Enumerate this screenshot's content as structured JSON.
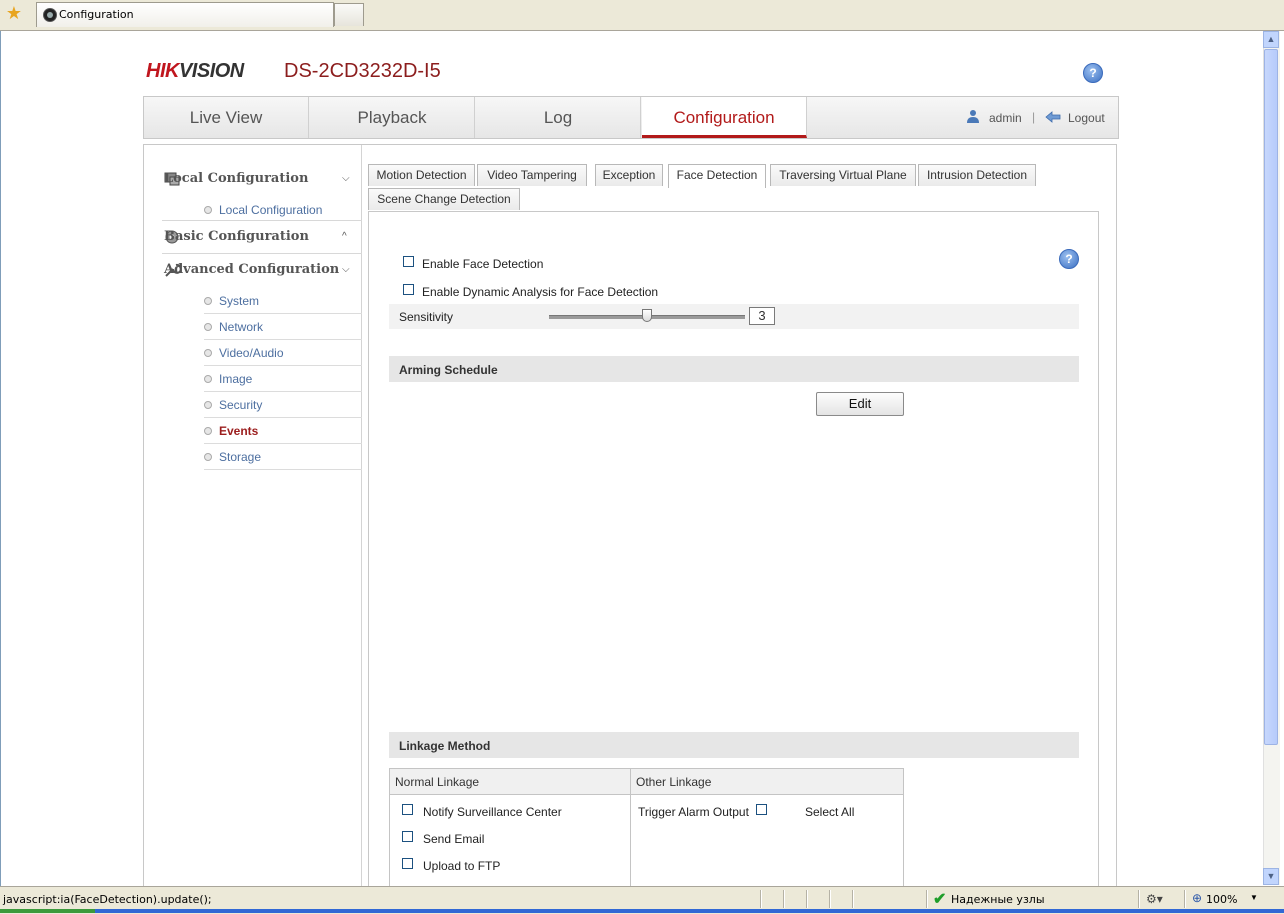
{
  "browser": {
    "tab_title": "Configuration",
    "status_text": "javascript:ia(FaceDetection).update();",
    "zone_text": "Надежные узлы",
    "zoom": "100%"
  },
  "header": {
    "logo_hik": "HIK",
    "logo_vision": "VISION",
    "model": "DS-2CD3232D-I5",
    "help": "?"
  },
  "nav": {
    "tabs": [
      "Live View",
      "Playback",
      "Log",
      "Configuration"
    ],
    "active": "Configuration",
    "user": "admin",
    "separator": "|",
    "logout": "Logout"
  },
  "sidebar": {
    "local_config": {
      "label": "Local Configuration",
      "items": [
        "Local Configuration"
      ]
    },
    "basic_config": {
      "label": "Basic Configuration"
    },
    "advanced_config": {
      "label": "Advanced Configuration",
      "items": [
        "System",
        "Network",
        "Video/Audio",
        "Image",
        "Security",
        "Events",
        "Storage"
      ],
      "active": "Events"
    }
  },
  "subtabs": {
    "items": [
      "Motion Detection",
      "Video Tampering",
      "Exception",
      "Face Detection",
      "Traversing Virtual Plane",
      "Intrusion Detection",
      "Scene Change Detection"
    ],
    "active": "Face Detection"
  },
  "face_detection": {
    "enable_label": "Enable Face Detection",
    "enable_checked": false,
    "dynamic_label": "Enable Dynamic Analysis for Face Detection",
    "dynamic_checked": false,
    "sensitivity_label": "Sensitivity",
    "sensitivity_value": "3",
    "sensitivity_fraction": 0.5
  },
  "arming_schedule": {
    "title": "Arming Schedule",
    "edit_label": "Edit"
  },
  "linkage": {
    "title": "Linkage Method",
    "normal_header": "Normal Linkage",
    "other_header": "Other Linkage",
    "normal_items": [
      "Notify Surveillance Center",
      "Send Email",
      "Upload to FTP"
    ],
    "trigger_label": "Trigger Alarm Output",
    "select_all": "Select All"
  }
}
